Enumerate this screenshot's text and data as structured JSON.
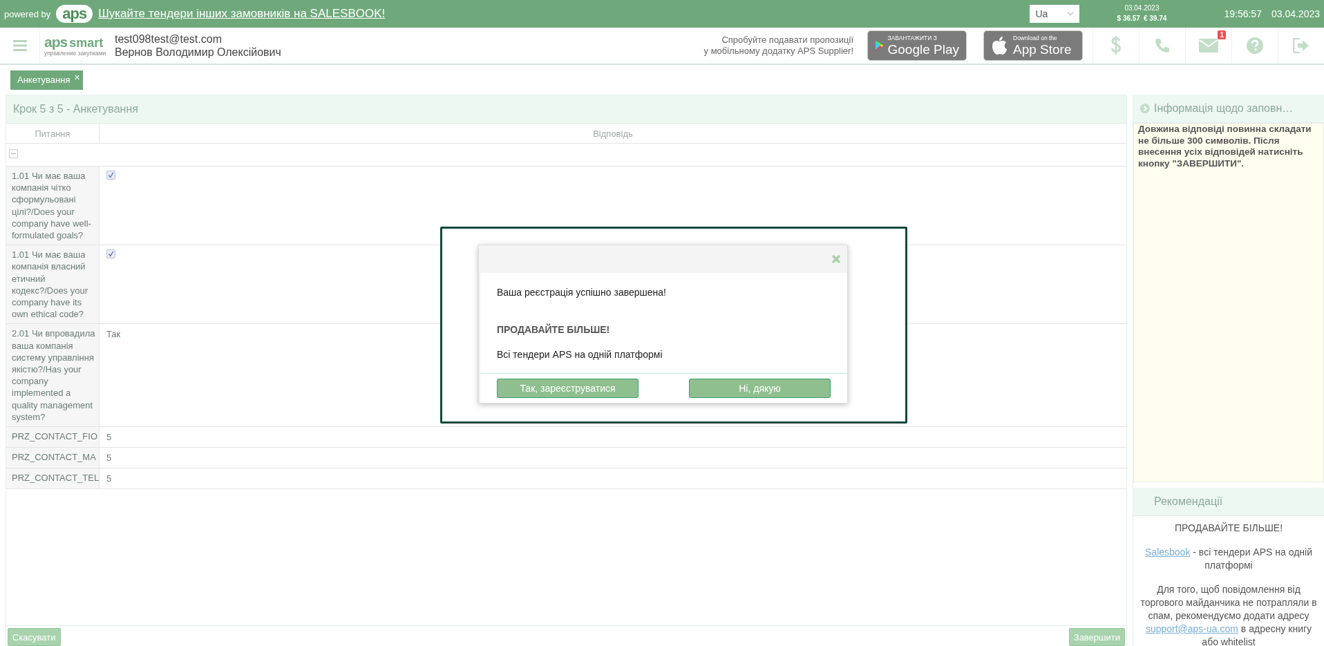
{
  "top_bar": {
    "powered_by": "powered by",
    "logo": "aps",
    "promo_link": "Шукайте тендери інших замовників на SALESBOOK!",
    "language": "Ua",
    "rates": {
      "date": "03.04.2023",
      "usd": "$ 36.57",
      "eur": "€ 39.74"
    },
    "time": "19:56:57",
    "date": "03.04.2023"
  },
  "header": {
    "logo": "aps",
    "logo_word": "smart",
    "logo_subtitle": "управление закупками",
    "email": "test098test@test.com",
    "user_name": "Вернов Володимир Олексійович",
    "promo": [
      "Спробуйте подавати пропозиції",
      "у мобільному додатку APS Supplier!"
    ],
    "store_badges": [
      {
        "kind": "google",
        "small": "ЗАВАНТАЖИТИ З",
        "big": "Google Play"
      },
      {
        "kind": "apple",
        "small": "Download on the",
        "big": "App Store"
      }
    ],
    "icons": [
      {
        "kind": "dollar"
      },
      {
        "kind": "phone"
      },
      {
        "kind": "mail",
        "badge": "1"
      },
      {
        "kind": "help"
      },
      {
        "kind": "logout"
      }
    ]
  },
  "tabs": [
    {
      "label": "Анкетування",
      "close": "×",
      "selected": true
    }
  ],
  "form": {
    "title": "Крок 5 з 5 - Анкетування",
    "columns": [
      "Питання",
      "Відповідь"
    ],
    "group": {
      "expanded": true
    },
    "rows": [
      {
        "kind": "checkbox",
        "question": "1.01 Чи має ваша компанія чітко сформульовані цілі?/Does your company have well-formulated goals?",
        "checked": true
      },
      {
        "kind": "checkbox",
        "question": "1.01 Чи має ваша компанія власний етичний кодекс?/Does your company have its own ethical code?",
        "checked": true
      },
      {
        "kind": "text",
        "question": "2.01 Чи впровадила ваша компанія систему управління якістю?/Has your company implemented a quality management system?",
        "answer": "Так"
      },
      {
        "kind": "text",
        "question": "PRZ_CONTACT_FIO",
        "answer": "5"
      },
      {
        "kind": "text",
        "question": "PRZ_CONTACT_MA",
        "answer": "5"
      },
      {
        "kind": "text",
        "question": "PRZ_CONTACT_TEL",
        "answer": "5"
      }
    ],
    "buttons": [
      {
        "label": "Скасувати"
      },
      {
        "label": "Завершити"
      }
    ]
  },
  "info_panel": {
    "title": "Інформація щодо заповн…",
    "text": "Довжина відповіді повинна складати не більше 300 символів. Після внесення усіх відповідей натисніть кнопку \"ЗАВЕРШИТИ\"."
  },
  "recommendations": {
    "title": "Рекомендації",
    "paragraphs": [
      [
        {
          "text": "ПРОДАВАЙТЕ БІЛЬШЕ!"
        }
      ],
      [
        {
          "text": "Salesbook",
          "link": true
        },
        {
          "text": " - всі тендери APS на одній платформі"
        }
      ],
      [
        {
          "text": "Для того, щоб повідомлення від торгового майданчика не потрапляли в спам, рекомендуємо додати адресу "
        },
        {
          "text": "support@aps-ua.com",
          "link": true
        },
        {
          "text": " в адресну книгу або whitelist"
        }
      ]
    ]
  },
  "dialog": {
    "message": "Ваша реєстрація успішно завершена!",
    "headline": "ПРОДАВАЙТЕ БІЛЬШЕ!",
    "text": "Всі тендери APS на одній платформі",
    "buttons": [
      {
        "label": "Так, зареєструватися"
      },
      {
        "label": "Ні, дякую"
      }
    ]
  }
}
